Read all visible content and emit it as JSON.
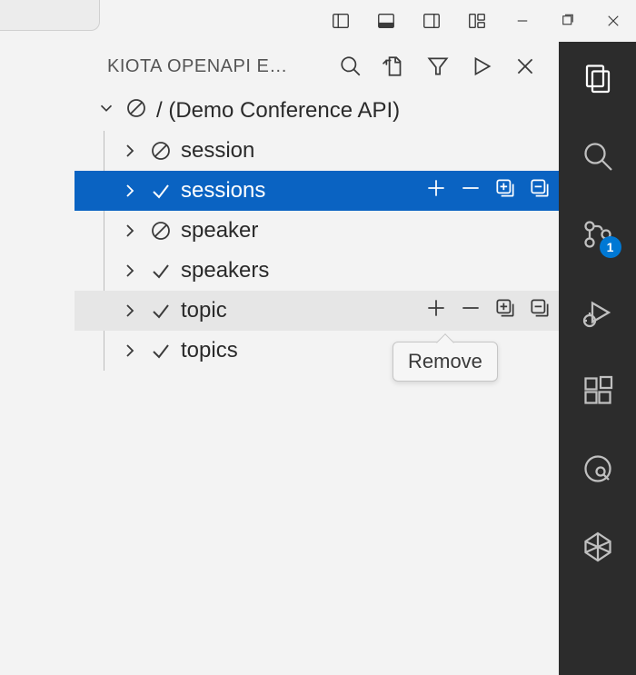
{
  "panel": {
    "title": "KIOTA OPENAPI EX…",
    "actions": {
      "search": "Search",
      "openfile": "Open File",
      "filter": "Filter",
      "generate": "Generate",
      "close": "Close"
    }
  },
  "tree": {
    "root_label": "/ (Demo Conference API)",
    "items": [
      {
        "label": "session",
        "state": "excluded",
        "selected": false,
        "hovered": false,
        "show_actions": false
      },
      {
        "label": "sessions",
        "state": "included",
        "selected": true,
        "hovered": false,
        "show_actions": true
      },
      {
        "label": "speaker",
        "state": "excluded",
        "selected": false,
        "hovered": false,
        "show_actions": false
      },
      {
        "label": "speakers",
        "state": "included",
        "selected": false,
        "hovered": false,
        "show_actions": false
      },
      {
        "label": "topic",
        "state": "included",
        "selected": false,
        "hovered": true,
        "show_actions": true
      },
      {
        "label": "topics",
        "state": "included",
        "selected": false,
        "hovered": false,
        "show_actions": false
      }
    ],
    "inline_actions": {
      "add": "Add",
      "remove": "Remove",
      "add_all": "Add all",
      "remove_all": "Remove all"
    }
  },
  "tooltip": {
    "text": "Remove"
  },
  "activitybar": {
    "badge": "1"
  }
}
